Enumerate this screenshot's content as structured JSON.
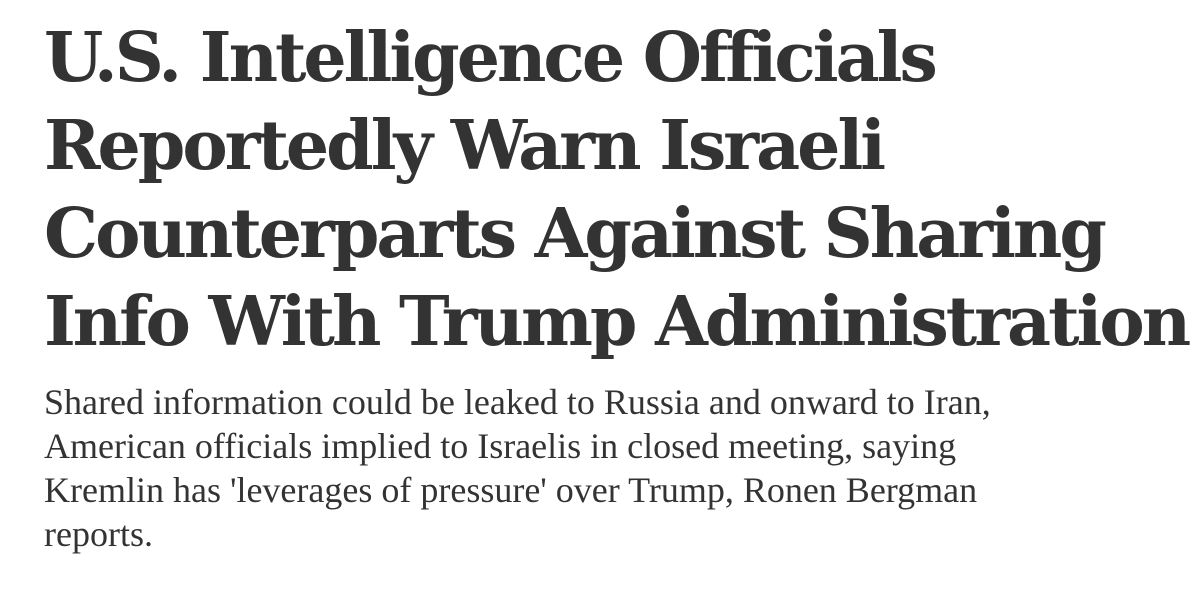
{
  "article": {
    "headline_lines": [
      "U.S. Intelligence Officials",
      "Reportedly Warn Israeli",
      "Counterparts Against Sharing",
      "Info With Trump Administration"
    ],
    "summary_lines": [
      "Shared information could be leaked to Russia and onward to Iran,",
      "American officials implied to Israelis in closed meeting, saying",
      "Kremlin has 'leverages of pressure' over Trump, Ronen Bergman",
      "reports."
    ]
  },
  "colors": {
    "text": "#333333",
    "background": "#ffffff"
  }
}
